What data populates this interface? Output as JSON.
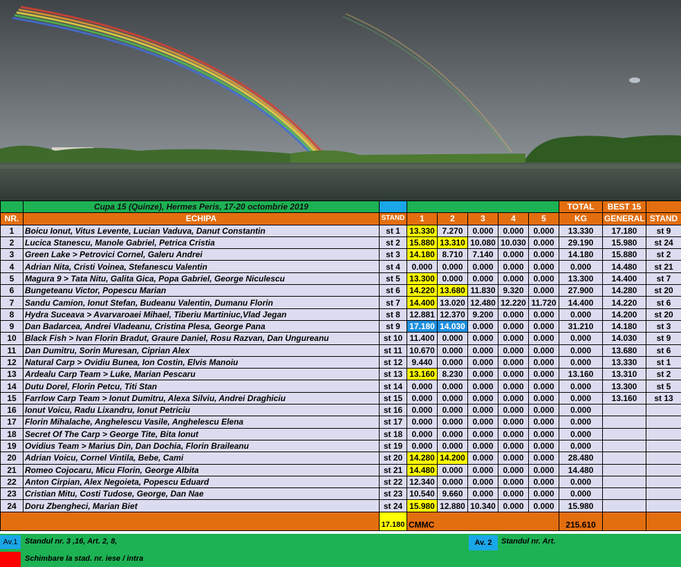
{
  "title": "Cupa 15 (Quinze), Hermes Peris, 17-20 octombrie 2019",
  "headers": {
    "nr": "NR.",
    "echipa": "ECHIPA",
    "stand": "STAND",
    "days": [
      "1",
      "2",
      "3",
      "4",
      "5"
    ],
    "total_top": "TOTAL",
    "total_bottom": "KG",
    "best_top": "BEST 15",
    "best_bottom": "GENERAL",
    "stand2": "STAND"
  },
  "rows": [
    {
      "nr": "1",
      "team": "Boicu Ionut, Vitus Levente, Lucian Vaduva, Danut Constantin",
      "stand": "st 1",
      "days": [
        "13.330",
        "7.270",
        "0.000",
        "0.000",
        "0.000"
      ],
      "hl": [
        "y",
        "",
        "",
        "",
        ""
      ],
      "total": "13.330",
      "best": "17.180",
      "bstand": "st 9"
    },
    {
      "nr": "2",
      "team": "Lucica Stanescu, Manole Gabriel, Petrica Cristia",
      "stand": "st 2",
      "days": [
        "15.880",
        "13.310",
        "10.080",
        "10.030",
        "0.000"
      ],
      "hl": [
        "y",
        "y",
        "",
        "",
        ""
      ],
      "total": "29.190",
      "best": "15.980",
      "bstand": "st 24"
    },
    {
      "nr": "3",
      "team": "Green Lake > Petrovici Cornel, Galeru Andrei",
      "stand": "st 3",
      "days": [
        "14.180",
        "8.710",
        "7.140",
        "0.000",
        "0.000"
      ],
      "hl": [
        "y",
        "",
        "",
        "",
        ""
      ],
      "total": "14.180",
      "best": "15.880",
      "bstand": "st 2"
    },
    {
      "nr": "4",
      "team": "Adrian Nita, Cristi Voinea, Stefanescu Valentin",
      "stand": "st 4",
      "days": [
        "0.000",
        "0.000",
        "0.000",
        "0.000",
        "0.000"
      ],
      "hl": [
        "",
        "",
        "",
        "",
        ""
      ],
      "total": "0.000",
      "best": "14.480",
      "bstand": "st 21"
    },
    {
      "nr": "5",
      "team": "Magura 9  > Tata Nitu, Galita Gica, Popa Gabriel, George Niculescu",
      "stand": "st 5",
      "days": [
        "13.300",
        "0.000",
        "0.000",
        "0.000",
        "0.000"
      ],
      "hl": [
        "y",
        "",
        "",
        "",
        ""
      ],
      "total": "13.300",
      "best": "14.400",
      "bstand": "st 7"
    },
    {
      "nr": "6",
      "team": "Bungeteanu Victor, Popescu Marian",
      "stand": "st 6",
      "days": [
        "14.220",
        "13.680",
        "11.830",
        "9.320",
        "0.000"
      ],
      "hl": [
        "y",
        "y",
        "",
        "",
        ""
      ],
      "total": "27.900",
      "best": "14.280",
      "bstand": "st 20"
    },
    {
      "nr": "7",
      "team": "Sandu Camion, Ionut Stefan, Budeanu Valentin, Dumanu Florin",
      "stand": "st 7",
      "days": [
        "14.400",
        "13.020",
        "12.480",
        "12.220",
        "11.720"
      ],
      "hl": [
        "y",
        "",
        "",
        "",
        ""
      ],
      "total": "14.400",
      "best": "14.220",
      "bstand": "st 6"
    },
    {
      "nr": "8",
      "team": "Hydra Suceava > Avarvaroaei Mihael, Tiberiu Martiniuc,Vlad Jegan",
      "stand": "st 8",
      "days": [
        "12.881",
        "12.370",
        "9.200",
        "0.000",
        "0.000"
      ],
      "hl": [
        "",
        "",
        "",
        "",
        ""
      ],
      "total": "0.000",
      "best": "14.200",
      "bstand": "st 20"
    },
    {
      "nr": "9",
      "team": "Dan Badarcea, Andrei Vladeanu, Cristina Plesa, George Pana",
      "stand": "st 9",
      "days": [
        "17.180",
        "14.030",
        "0.000",
        "0.000",
        "0.000"
      ],
      "hl": [
        "b",
        "b",
        "",
        "",
        ""
      ],
      "total": "31.210",
      "best": "14.180",
      "bstand": "st 3"
    },
    {
      "nr": "10",
      "team": "Black Fish > Ivan Florin Bradut, Graure Daniel, Rosu Razvan, Dan Ungureanu",
      "stand": "st 10",
      "days": [
        "11.400",
        "0.000",
        "0.000",
        "0.000",
        "0.000"
      ],
      "hl": [
        "",
        "",
        "",
        "",
        ""
      ],
      "total": "0.000",
      "best": "14.030",
      "bstand": "st 9"
    },
    {
      "nr": "11",
      "team": "Dan Dumitru, Sorin Muresan, Ciprian Alex",
      "stand": "st 11",
      "days": [
        "10.670",
        "0.000",
        "0.000",
        "0.000",
        "0.000"
      ],
      "hl": [
        "",
        "",
        "",
        "",
        ""
      ],
      "total": "0.000",
      "best": "13.680",
      "bstand": "st 6"
    },
    {
      "nr": "12",
      "team": "Natural Carp > Ovidiu Bunea, Ion Costin, Elvis Manoiu",
      "stand": "st 12",
      "days": [
        "9.440",
        "0.000",
        "0.000",
        "0.000",
        "0.000"
      ],
      "hl": [
        "",
        "",
        "",
        "",
        ""
      ],
      "total": "0.000",
      "best": "13.330",
      "bstand": "st 1"
    },
    {
      "nr": "13",
      "team": "Ardealu Carp Team  > Luke, Marian Pescaru",
      "stand": "st 13",
      "days": [
        "13.160",
        "8.230",
        "0.000",
        "0.000",
        "0.000"
      ],
      "hl": [
        "y",
        "",
        "",
        "",
        ""
      ],
      "total": "13.160",
      "best": "13.310",
      "bstand": "st 2"
    },
    {
      "nr": "14",
      "team": "Dutu Dorel, Florin Petcu, Titi Stan",
      "stand": "st 14",
      "days": [
        "0.000",
        "0.000",
        "0.000",
        "0.000",
        "0.000"
      ],
      "hl": [
        "",
        "",
        "",
        "",
        ""
      ],
      "total": "0.000",
      "best": "13.300",
      "bstand": "st 5"
    },
    {
      "nr": "15",
      "team": "Farrlow Carp Team > Ionut Dumitru, Alexa Silviu, Andrei Draghiciu",
      "stand": "st 15",
      "days": [
        "0.000",
        "0.000",
        "0.000",
        "0.000",
        "0.000"
      ],
      "hl": [
        "",
        "",
        "",
        "",
        ""
      ],
      "total": "0.000",
      "best": "13.160",
      "bstand": "st 13"
    },
    {
      "nr": "16",
      "team": "Ionut Voicu, Radu Lixandru, Ionut Petriciu",
      "stand": "st 16",
      "days": [
        "0.000",
        "0.000",
        "0.000",
        "0.000",
        "0.000"
      ],
      "hl": [
        "",
        "",
        "",
        "",
        ""
      ],
      "total": "0.000",
      "best": "",
      "bstand": ""
    },
    {
      "nr": "17",
      "team": "Florin Mihalache, Anghelescu Vasile, Anghelescu Elena",
      "stand": "st 17",
      "days": [
        "0.000",
        "0.000",
        "0.000",
        "0.000",
        "0.000"
      ],
      "hl": [
        "",
        "",
        "",
        "",
        ""
      ],
      "total": "0.000",
      "best": "",
      "bstand": ""
    },
    {
      "nr": "18",
      "team": "Secret Of The Carp >  George Tite, Bita Ionut",
      "stand": "st 18",
      "days": [
        "0.000",
        "0.000",
        "0.000",
        "0.000",
        "0.000"
      ],
      "hl": [
        "",
        "",
        "",
        "",
        ""
      ],
      "total": "0.000",
      "best": "",
      "bstand": ""
    },
    {
      "nr": "19",
      "team": "Ovidius Team > Marius Din, Dan Dochia, Florin Braileanu",
      "stand": "st 19",
      "days": [
        "0.000",
        "0.000",
        "0.000",
        "0.000",
        "0.000"
      ],
      "hl": [
        "",
        "",
        "",
        "",
        ""
      ],
      "total": "0.000",
      "best": "",
      "bstand": ""
    },
    {
      "nr": "20",
      "team": "Adrian Voicu, Cornel Vintila, Bebe, Cami",
      "stand": "st 20",
      "days": [
        "14.280",
        "14.200",
        "0.000",
        "0.000",
        "0.000"
      ],
      "hl": [
        "y",
        "y",
        "",
        "",
        ""
      ],
      "total": "28.480",
      "best": "",
      "bstand": ""
    },
    {
      "nr": "21",
      "team": "Romeo Cojocaru, Micu Florin, George Albita",
      "stand": "st 21",
      "days": [
        "14.480",
        "0.000",
        "0.000",
        "0.000",
        "0.000"
      ],
      "hl": [
        "y",
        "",
        "",
        "",
        ""
      ],
      "total": "14.480",
      "best": "",
      "bstand": ""
    },
    {
      "nr": "22",
      "team": "Anton Cirpian, Alex Negoieta, Popescu Eduard",
      "stand": "st 22",
      "days": [
        "12.340",
        "0.000",
        "0.000",
        "0.000",
        "0.000"
      ],
      "hl": [
        "",
        "",
        "",
        "",
        ""
      ],
      "total": "0.000",
      "best": "",
      "bstand": ""
    },
    {
      "nr": "23",
      "team": "Cristian Mitu, Costi Tudose, George, Dan Nae",
      "stand": "st 23",
      "days": [
        "10.540",
        "9.660",
        "0.000",
        "0.000",
        "0.000"
      ],
      "hl": [
        "",
        "",
        "",
        "",
        ""
      ],
      "total": "0.000",
      "best": "",
      "bstand": ""
    },
    {
      "nr": "24",
      "team": "Doru Zbengheci, Marian Biet",
      "stand": "st 24",
      "days": [
        "15.980",
        "12.880",
        "10.340",
        "0.000",
        "0.000"
      ],
      "hl": [
        "y",
        "",
        "",
        "",
        ""
      ],
      "total": "15.980",
      "best": "",
      "bstand": ""
    }
  ],
  "summary": {
    "cmmc_value": "17.180",
    "cmmc_label": "CMMC",
    "grand_total": "215.610"
  },
  "footer": {
    "av1": "Av.1",
    "av1_text": "Standul nr.  3 ,16,   Art. 2, 8,",
    "av2": "Av. 2",
    "av2_text": "Standul  nr.       Art.",
    "change_text": "Schimbare la stad.  nr.       iese / intra"
  },
  "colors": {
    "green": "#1db254",
    "orange": "#e36e0f",
    "blue": "#1aa7e8",
    "lavender": "#dcdcf0",
    "yellow": "#ffff00",
    "red": "#ff0000"
  }
}
